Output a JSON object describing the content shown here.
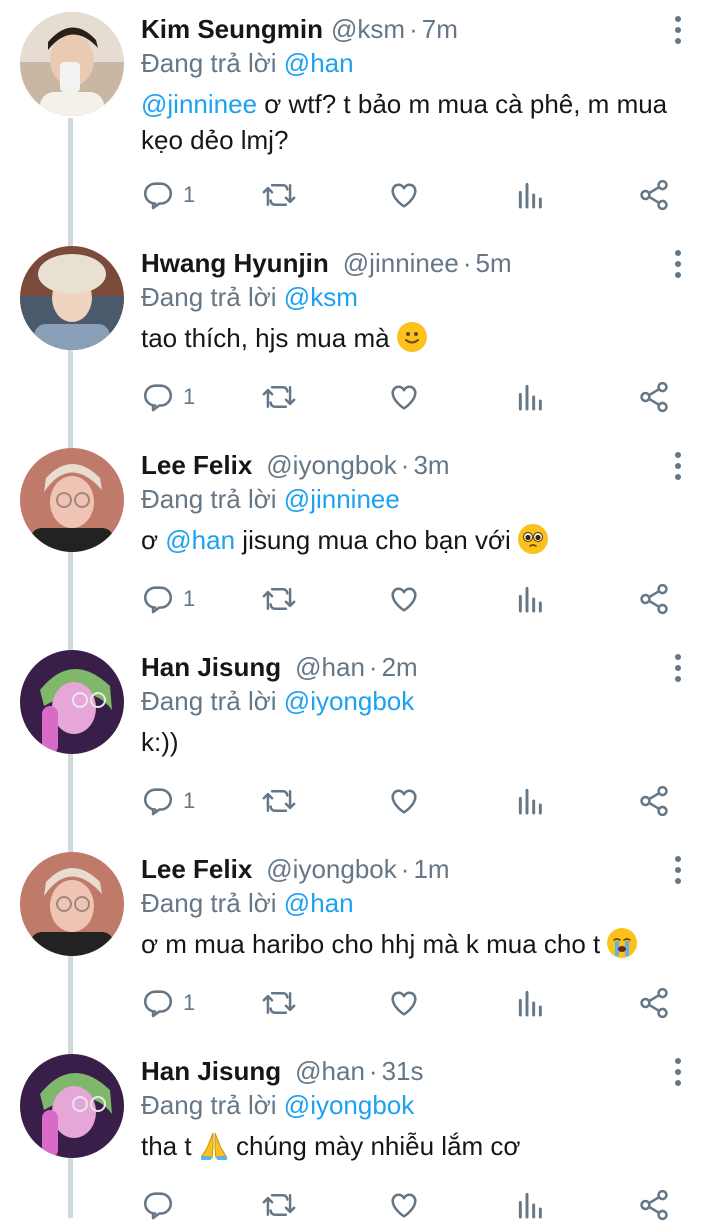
{
  "reply_prefix": "Đang trả lời",
  "colors": {
    "mention": "#1da1f2",
    "muted": "#657786",
    "thread_line": "#cfd9de"
  },
  "tweets": [
    {
      "name": "Kim Seungmin",
      "handle": "@ksm",
      "time": "7m",
      "reply_to": "@han",
      "mention": "@jinninee",
      "text_a": " ơ wtf? t bảo m mua cà phê, m mua kẹo dẻo lmj?",
      "replies": "1",
      "avatar": "seungmin-avatar"
    },
    {
      "name": "Hwang Hyunjin",
      "handle": "@jinninee",
      "time": "5m",
      "reply_to": "@ksm",
      "text_a": "tao thích, hjs mua mà ",
      "emoji": "slightly-smiling-face",
      "replies": "1",
      "avatar": "hyunjin-avatar"
    },
    {
      "name": "Lee Felix",
      "handle": "@iyongbok",
      "time": "3m",
      "reply_to": "@jinninee",
      "text_a": "ơ ",
      "mention": "@han",
      "text_b": " jisung mua cho bạn với ",
      "emoji": "pleading-face",
      "replies": "1",
      "avatar": "felix-avatar"
    },
    {
      "name": "Han Jisung",
      "handle": "@han",
      "time": "2m",
      "reply_to": "@iyongbok",
      "text_a": "k:))",
      "replies": "1",
      "avatar": "jisung-avatar"
    },
    {
      "name": "Lee Felix",
      "handle": "@iyongbok",
      "time": "1m",
      "reply_to": "@han",
      "text_a": "ơ m mua haribo cho hhj mà k mua cho t ",
      "emoji": "loudly-crying-face",
      "replies": "1",
      "avatar": "felix-avatar"
    },
    {
      "name": "Han Jisung",
      "handle": "@han",
      "time": "31s",
      "reply_to": "@iyongbok",
      "text_a": "tha t ",
      "emoji": "folded-hands",
      "text_b": " chúng mày nhiễu lắm cơ",
      "replies": "",
      "avatar": "jisung-avatar"
    }
  ],
  "icons": {
    "reply": "reply-icon",
    "retweet": "retweet-icon",
    "like": "heart-icon",
    "views": "bar-chart-icon",
    "share": "share-icon",
    "more": "more-vertical-icon"
  }
}
